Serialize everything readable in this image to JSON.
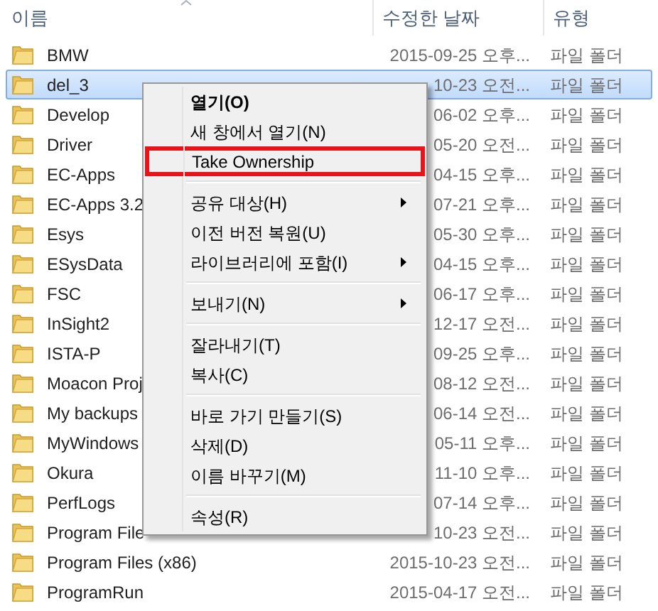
{
  "columns": [
    {
      "label": "이름"
    },
    {
      "label": "수정한 날짜"
    },
    {
      "label": "유형"
    }
  ],
  "rows": [
    {
      "name": "BMW",
      "date": "2015-09-25 오후...",
      "type": "파일 폴더",
      "selected": false
    },
    {
      "name": "del_3",
      "date": "10-23 오전...",
      "type": "파일 폴더",
      "selected": true
    },
    {
      "name": "Develop",
      "date": "06-02 오후...",
      "type": "파일 폴더",
      "selected": false
    },
    {
      "name": "Driver",
      "date": "05-20 오전...",
      "type": "파일 폴더",
      "selected": false
    },
    {
      "name": "EC-Apps",
      "date": "04-15 오후...",
      "type": "파일 폴더",
      "selected": false
    },
    {
      "name": "EC-Apps 3.2",
      "date": "07-21 오후...",
      "type": "파일 폴더",
      "selected": false
    },
    {
      "name": "Esys",
      "date": "05-30 오후...",
      "type": "파일 폴더",
      "selected": false
    },
    {
      "name": "ESysData",
      "date": "04-15 오후...",
      "type": "파일 폴더",
      "selected": false
    },
    {
      "name": "FSC",
      "date": "06-17 오후...",
      "type": "파일 폴더",
      "selected": false
    },
    {
      "name": "InSight2",
      "date": "12-17 오전...",
      "type": "파일 폴더",
      "selected": false
    },
    {
      "name": "ISTA-P",
      "date": "09-25 오후...",
      "type": "파일 폴더",
      "selected": false
    },
    {
      "name": "Moacon Proj",
      "date": "08-12 오전...",
      "type": "파일 폴더",
      "selected": false
    },
    {
      "name": "My backups",
      "date": "06-14 오전...",
      "type": "파일 폴더",
      "selected": false
    },
    {
      "name": "MyWindows",
      "date": "05-11 오후...",
      "type": "파일 폴더",
      "selected": false
    },
    {
      "name": "Okura",
      "date": "11-10 오후...",
      "type": "파일 폴더",
      "selected": false
    },
    {
      "name": "PerfLogs",
      "date": "07-14 오후...",
      "type": "파일 폴더",
      "selected": false
    },
    {
      "name": "Program File",
      "date": "10-23 오전...",
      "type": "파일 폴더",
      "selected": false
    },
    {
      "name": "Program Files (x86)",
      "date": "2015-10-23 오전...",
      "type": "파일 폴더",
      "selected": false
    },
    {
      "name": "ProgramRun",
      "date": "2015-04-17 오전...",
      "type": "파일 폴더",
      "selected": false
    }
  ],
  "context_menu": [
    {
      "kind": "item",
      "label": "열기(O)",
      "default": true,
      "highlighted": false,
      "submenu": false
    },
    {
      "kind": "item",
      "label": "새 창에서 열기(N)",
      "default": false,
      "highlighted": false,
      "submenu": false
    },
    {
      "kind": "item",
      "label": "Take Ownership",
      "default": false,
      "highlighted": true,
      "submenu": false
    },
    {
      "kind": "separator"
    },
    {
      "kind": "item",
      "label": "공유 대상(H)",
      "default": false,
      "highlighted": false,
      "submenu": true
    },
    {
      "kind": "item",
      "label": "이전 버전 복원(U)",
      "default": false,
      "highlighted": false,
      "submenu": false
    },
    {
      "kind": "item",
      "label": "라이브러리에 포함(I)",
      "default": false,
      "highlighted": false,
      "submenu": true
    },
    {
      "kind": "separator"
    },
    {
      "kind": "item",
      "label": "보내기(N)",
      "default": false,
      "highlighted": false,
      "submenu": true
    },
    {
      "kind": "separator"
    },
    {
      "kind": "item",
      "label": "잘라내기(T)",
      "default": false,
      "highlighted": false,
      "submenu": false
    },
    {
      "kind": "item",
      "label": "복사(C)",
      "default": false,
      "highlighted": false,
      "submenu": false
    },
    {
      "kind": "separator"
    },
    {
      "kind": "item",
      "label": "바로 가기 만들기(S)",
      "default": false,
      "highlighted": false,
      "submenu": false
    },
    {
      "kind": "item",
      "label": "삭제(D)",
      "default": false,
      "highlighted": false,
      "submenu": false
    },
    {
      "kind": "item",
      "label": "이름 바꾸기(M)",
      "default": false,
      "highlighted": false,
      "submenu": false
    },
    {
      "kind": "separator"
    },
    {
      "kind": "item",
      "label": "속성(R)",
      "default": false,
      "highlighted": false,
      "submenu": false
    }
  ]
}
